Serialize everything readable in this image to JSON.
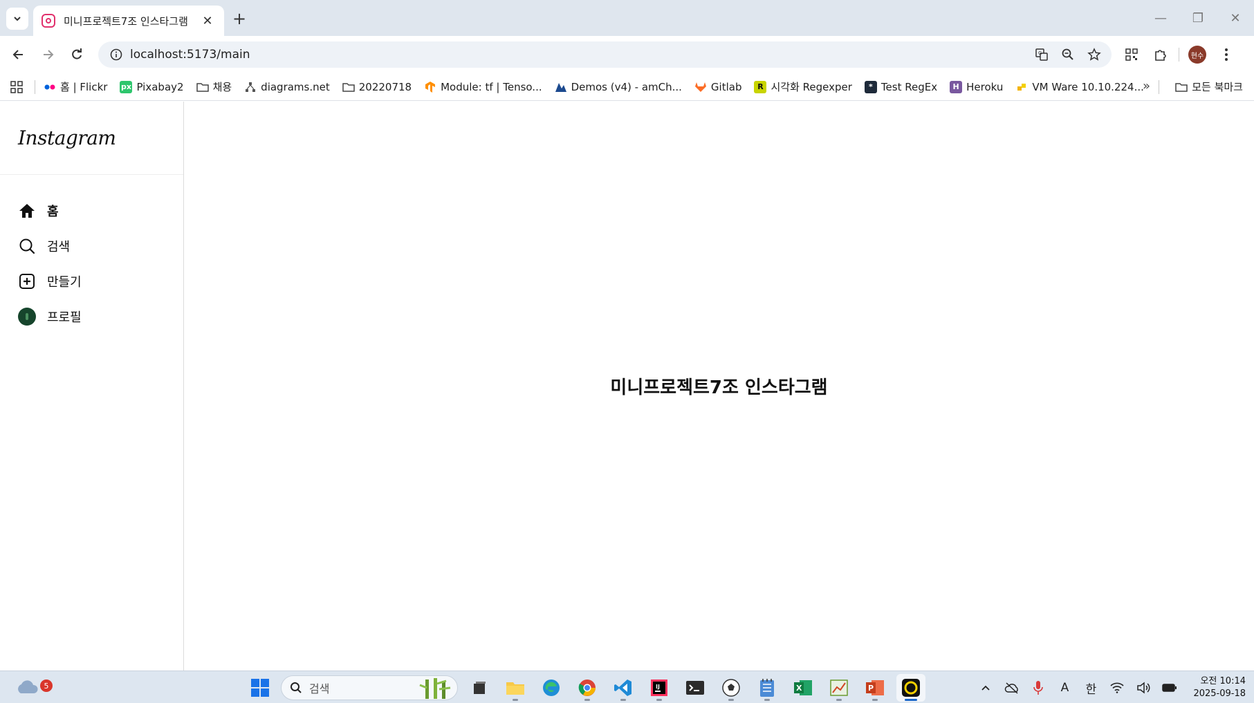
{
  "browser": {
    "tab_title": "미니프로젝트7조 인스타그램",
    "url": "localhost:5173/main",
    "profile_initials": "현수",
    "bookmarks": [
      {
        "label": "홈 | Flickr",
        "icon": "flickr-icon"
      },
      {
        "label": "Pixabay2",
        "icon": "pixabay-icon"
      },
      {
        "label": "채용",
        "icon": "folder-icon"
      },
      {
        "label": "diagrams.net",
        "icon": "diagrams-icon"
      },
      {
        "label": "20220718",
        "icon": "folder-icon"
      },
      {
        "label": "Module: tf  |  Tenso...",
        "icon": "tensorflow-icon"
      },
      {
        "label": "Demos (v4) - amCh...",
        "icon": "amcharts-icon"
      },
      {
        "label": "Gitlab",
        "icon": "gitlab-icon"
      },
      {
        "label": "시각화 Regexper",
        "icon": "regexper-icon"
      },
      {
        "label": "Test RegEx",
        "icon": "regex-icon"
      },
      {
        "label": "Heroku",
        "icon": "heroku-icon"
      },
      {
        "label": "VM Ware 10.10.224...",
        "icon": "vmware-icon"
      }
    ],
    "all_bookmarks_label": "모든 북마크"
  },
  "app": {
    "logo": "Instagram",
    "nav": [
      {
        "label": "홈",
        "icon": "home-icon"
      },
      {
        "label": "검색",
        "icon": "search-icon"
      },
      {
        "label": "만들기",
        "icon": "create-icon"
      },
      {
        "label": "프로필",
        "icon": "avatar"
      }
    ],
    "main_title": "미니프로젝트7조 인스타그램"
  },
  "taskbar": {
    "weather_badge": "5",
    "search_placeholder": "검색",
    "ime_letter": "A",
    "ime_lang": "한",
    "clock_time": "오전 10:14",
    "clock_date": "2025-09-18"
  }
}
